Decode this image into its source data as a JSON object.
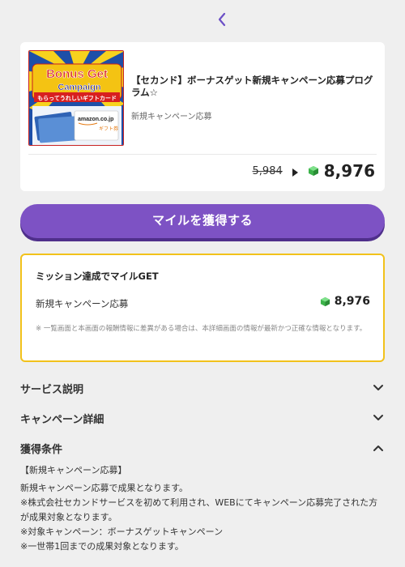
{
  "nav": {
    "back_icon": "chevron-left-icon",
    "accent": "#6b4fc6"
  },
  "offer": {
    "title": "【セカンド】ボーナスゲット新規キャンペーン応募プログラム☆",
    "category": "新規キャンペーン応募",
    "old_price": "5,984",
    "new_price": "8,976",
    "thumbnail": {
      "headline1": "Bonus Get",
      "headline2": "Campaign",
      "tagline": "もらってうれしいギフトカード",
      "card_brand": "amazon.co.jp",
      "card_sub": "ギフト券"
    }
  },
  "cta": {
    "label": "マイルを獲得する",
    "color": "#7d52c4"
  },
  "mission": {
    "heading": "ミッション達成でマイルGET",
    "item_label": "新規キャンペーン応募",
    "item_points": "8,976",
    "note": "※ 一覧画面と本画面の報酬情報に差異がある場合は、本詳細画面の情報が最新かつ正確な情報となります。",
    "border_color": "#f2c21b"
  },
  "accordions": [
    {
      "label": "サービス説明",
      "state": "collapsed"
    },
    {
      "label": "キャンペーン詳細",
      "state": "collapsed"
    },
    {
      "label": "獲得条件",
      "state": "expanded"
    }
  ],
  "conditions": {
    "heading": "【新規キャンペーン応募】",
    "lines": [
      "新規キャンペーン応募で成果となります。",
      "※株式会社セカンドサービスを初めて利用され、WEBにてキャンペーン応募完了された方が成果対象となります。",
      "※対象キャンペーン：ボーナスゲットキャンペーン",
      "※一世帯1回までの成果対象となります。"
    ]
  }
}
